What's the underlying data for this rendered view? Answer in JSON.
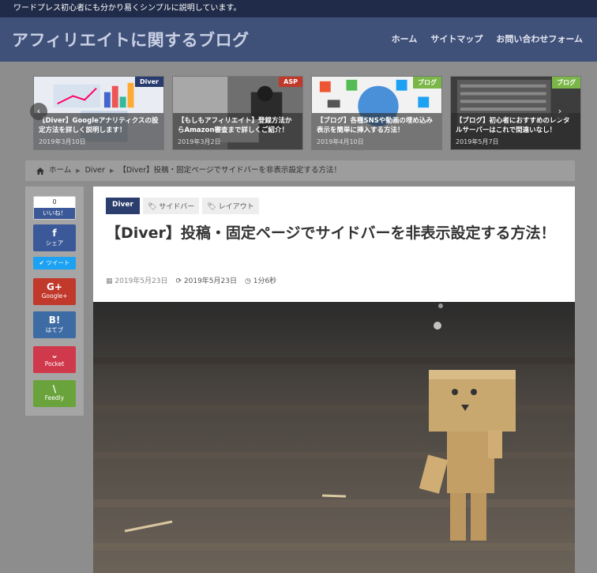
{
  "topbar": {
    "text": "ワードプレス初心者にも分かり易くシンプルに説明しています。"
  },
  "header": {
    "site_title": "アフィリエイトに関するブログ",
    "nav": [
      "ホーム",
      "サイトマップ",
      "お問い合わせフォーム"
    ]
  },
  "slider": {
    "prev_icon": "‹",
    "next_icon": "›",
    "slides": [
      {
        "badge": "Diver",
        "title": "【Diver】Googleアナリティクスの設定方法を詳しく説明します！",
        "date": "2019年3月10日",
        "badge_color": "#283b6e"
      },
      {
        "badge": "ASP",
        "title": "【もしもアフィリエイト】登録方法からAmazon審査まで詳しくご紹介！",
        "date": "2019年3月2日",
        "badge_color": "#c0392b"
      },
      {
        "badge": "ブログ",
        "title": "【ブログ】各種SNSや動画の埋め込み表示を簡単に挿入する方法！",
        "date": "2019年4月10日",
        "badge_color": "#7ab648"
      },
      {
        "badge": "ブログ",
        "title": "【ブログ】初心者におすすめのレンタルサーバーはこれで間違いなし！",
        "date": "2019年5月7日",
        "badge_color": "#7ab648"
      }
    ]
  },
  "breadcrumb": {
    "home": "ホーム",
    "category": "Diver",
    "current": "【Diver】投稿・固定ページでサイドバーを非表示設定する方法！"
  },
  "share": {
    "like_count": "0",
    "like_label": "いいね！",
    "facebook": "シェア",
    "twitter": "ツイート",
    "google": "Google+",
    "hatena_icon": "B!",
    "hatena": "はてブ",
    "pocket": "Pocket",
    "feedly": "Feedly"
  },
  "article": {
    "category": "Diver",
    "tags": [
      "サイドバー",
      "レイアウト"
    ],
    "title": "【Diver】投稿・固定ページでサイドバーを非表示設定する方法！",
    "published": "2019年5月23日",
    "updated": "2019年5月23日",
    "read_time": "1分6秒"
  }
}
